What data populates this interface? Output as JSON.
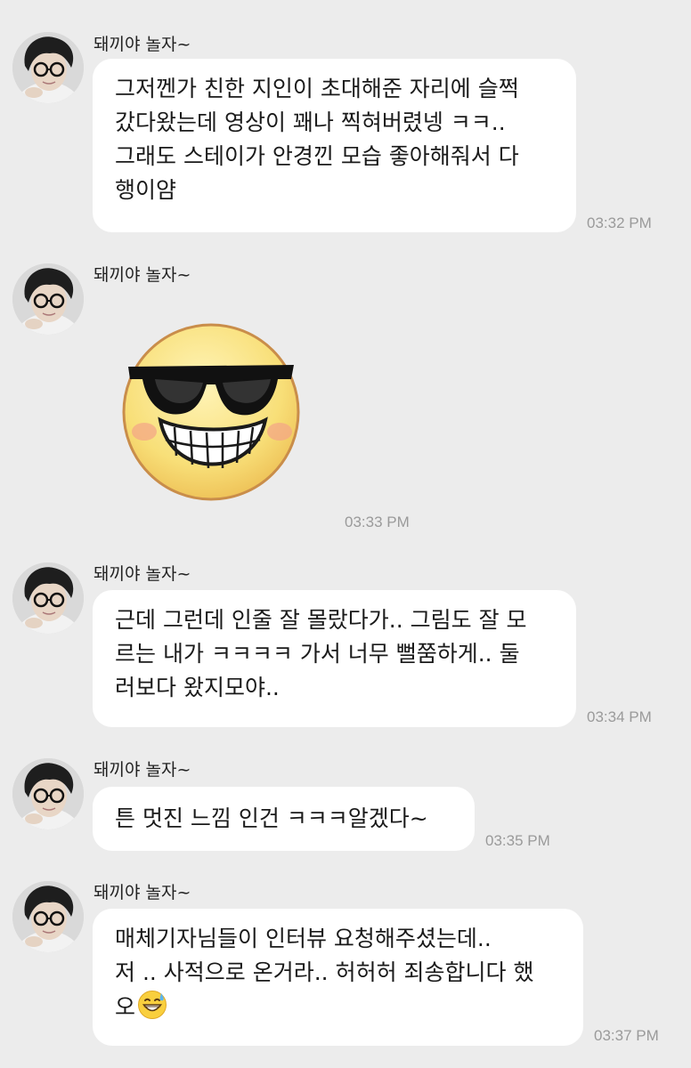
{
  "chat": {
    "messages": [
      {
        "sender": "돼끼야 놀자~",
        "lines": [
          "그저껜가 친한 지인이 초대해준 자리에 슬쩍",
          "갔다왔는데  영상이 꽤나 찍혀버렸넹 ㅋㅋ..",
          "그래도 스테이가 안경낀 모습 좋아해줘서 다",
          "행이얌"
        ],
        "time": "03:32 PM"
      },
      {
        "sender": "돼끼야 놀자~",
        "sticker": "sunglasses-smiley-sticker",
        "time": "03:33 PM"
      },
      {
        "sender": "돼끼야 놀자~",
        "lines": [
          "근데 그런데 인줄 잘 몰랐다가.. 그림도 잘 모",
          "르는 내가 ㅋㅋㅋㅋ 가서 너무 뻘쭘하게.. 둘",
          "러보다 왔지모야.."
        ],
        "time": "03:34 PM"
      },
      {
        "sender": "돼끼야 놀자~",
        "lines": [
          "튼 멋진 느낌 인건 ㅋㅋㅋ알겠다~"
        ],
        "time": "03:35 PM"
      },
      {
        "sender": "돼끼야 놀자~",
        "lines": [
          "매체기자님들이 인터뷰 요청해주셨는데..",
          "저 .. 사적으로 온거라.. 허허허 죄송합니다 했",
          "오"
        ],
        "emoji": "grinning-sweat-emoji",
        "time": "03:37 PM"
      }
    ]
  },
  "colors": {
    "background": "#ececec",
    "bubble": "#ffffff",
    "timestamp": "#9a9a9a",
    "sticker_face": "#f7dd7a"
  }
}
